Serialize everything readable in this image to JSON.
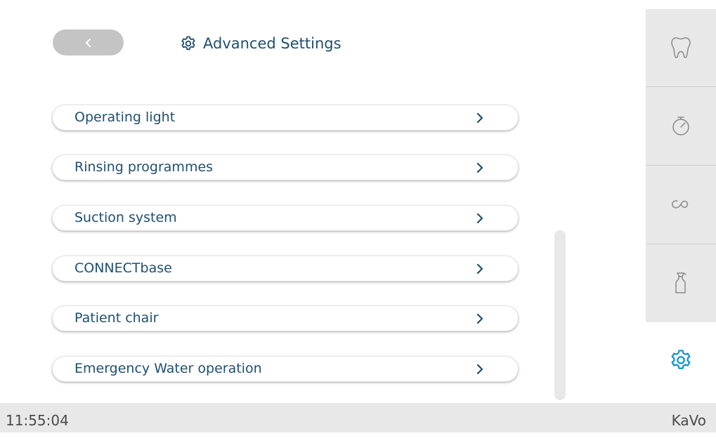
{
  "header": {
    "title": "Advanced Settings",
    "title_icon": "gear-icon",
    "back_icon": "chevron-left-icon"
  },
  "settings": {
    "items": [
      {
        "label": "Operating light",
        "icon": "chevron-right-icon"
      },
      {
        "label": "Rinsing programmes",
        "icon": "chevron-right-icon"
      },
      {
        "label": "Suction system",
        "icon": "chevron-right-icon"
      },
      {
        "label": "CONNECTbase",
        "icon": "chevron-right-icon"
      },
      {
        "label": "Patient chair",
        "icon": "chevron-right-icon"
      },
      {
        "label": "Emergency Water operation",
        "icon": "chevron-right-icon"
      }
    ]
  },
  "side_nav": {
    "tabs": [
      {
        "icon": "tooth-icon"
      },
      {
        "icon": "timer-icon"
      },
      {
        "icon": "infinity-icon"
      },
      {
        "icon": "spray-bottle-icon"
      },
      {
        "icon": "gear-icon",
        "active": true
      }
    ]
  },
  "status_bar": {
    "time": "11:55:04",
    "brand": "KaVo"
  },
  "colors": {
    "text": "#1f4f6e",
    "accent": "#1493d1",
    "panel": "#e8e8e8",
    "back_button": "#c4c4c4",
    "icon_muted": "#8a8a8a"
  }
}
